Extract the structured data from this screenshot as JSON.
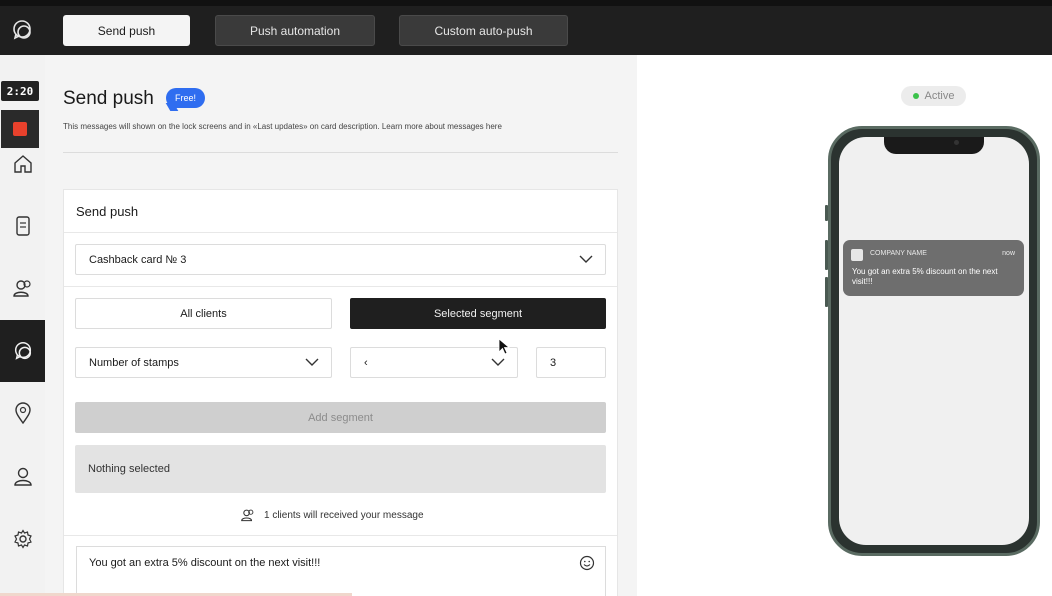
{
  "topbar": {
    "tabs": [
      {
        "label": "Send push",
        "active": true
      },
      {
        "label": "Push automation",
        "active": false
      },
      {
        "label": "Custom auto-push",
        "active": false
      }
    ]
  },
  "recorder": {
    "timer": "2:20"
  },
  "sidebar": {
    "items": [
      {
        "icon": "home-icon"
      },
      {
        "icon": "card-icon"
      },
      {
        "icon": "clients-icon"
      },
      {
        "icon": "chat-icon",
        "active": true
      },
      {
        "icon": "location-icon"
      },
      {
        "icon": "user-icon"
      },
      {
        "icon": "gear-icon"
      }
    ]
  },
  "page": {
    "title": "Send push",
    "badge": "Free!",
    "subtitle": "This messages will shown on the lock screens and in «Last updates» on card description. Learn more about messages here"
  },
  "form": {
    "card_title": "Send push",
    "card_select": "Cashback card № 3",
    "audience_all": "All clients",
    "audience_segment": "Selected segment",
    "segment_field": "Number of stamps",
    "segment_operator": "‹",
    "segment_value": "3",
    "add_segment": "Add segment",
    "nothing_selected": "Nothing selected",
    "recipients": "1 clients will received your message",
    "message": "You got an extra 5% discount on the next visit!!!"
  },
  "preview": {
    "status": "Active",
    "notification": {
      "company": "COMPANY NAME",
      "time": "now",
      "text": "You got an extra 5% discount on the next visit!!!"
    }
  },
  "colors": {
    "dark": "#1f1f1f",
    "badge": "#2f6df0",
    "record": "#e8412c",
    "active_dot": "#3bc24a"
  }
}
